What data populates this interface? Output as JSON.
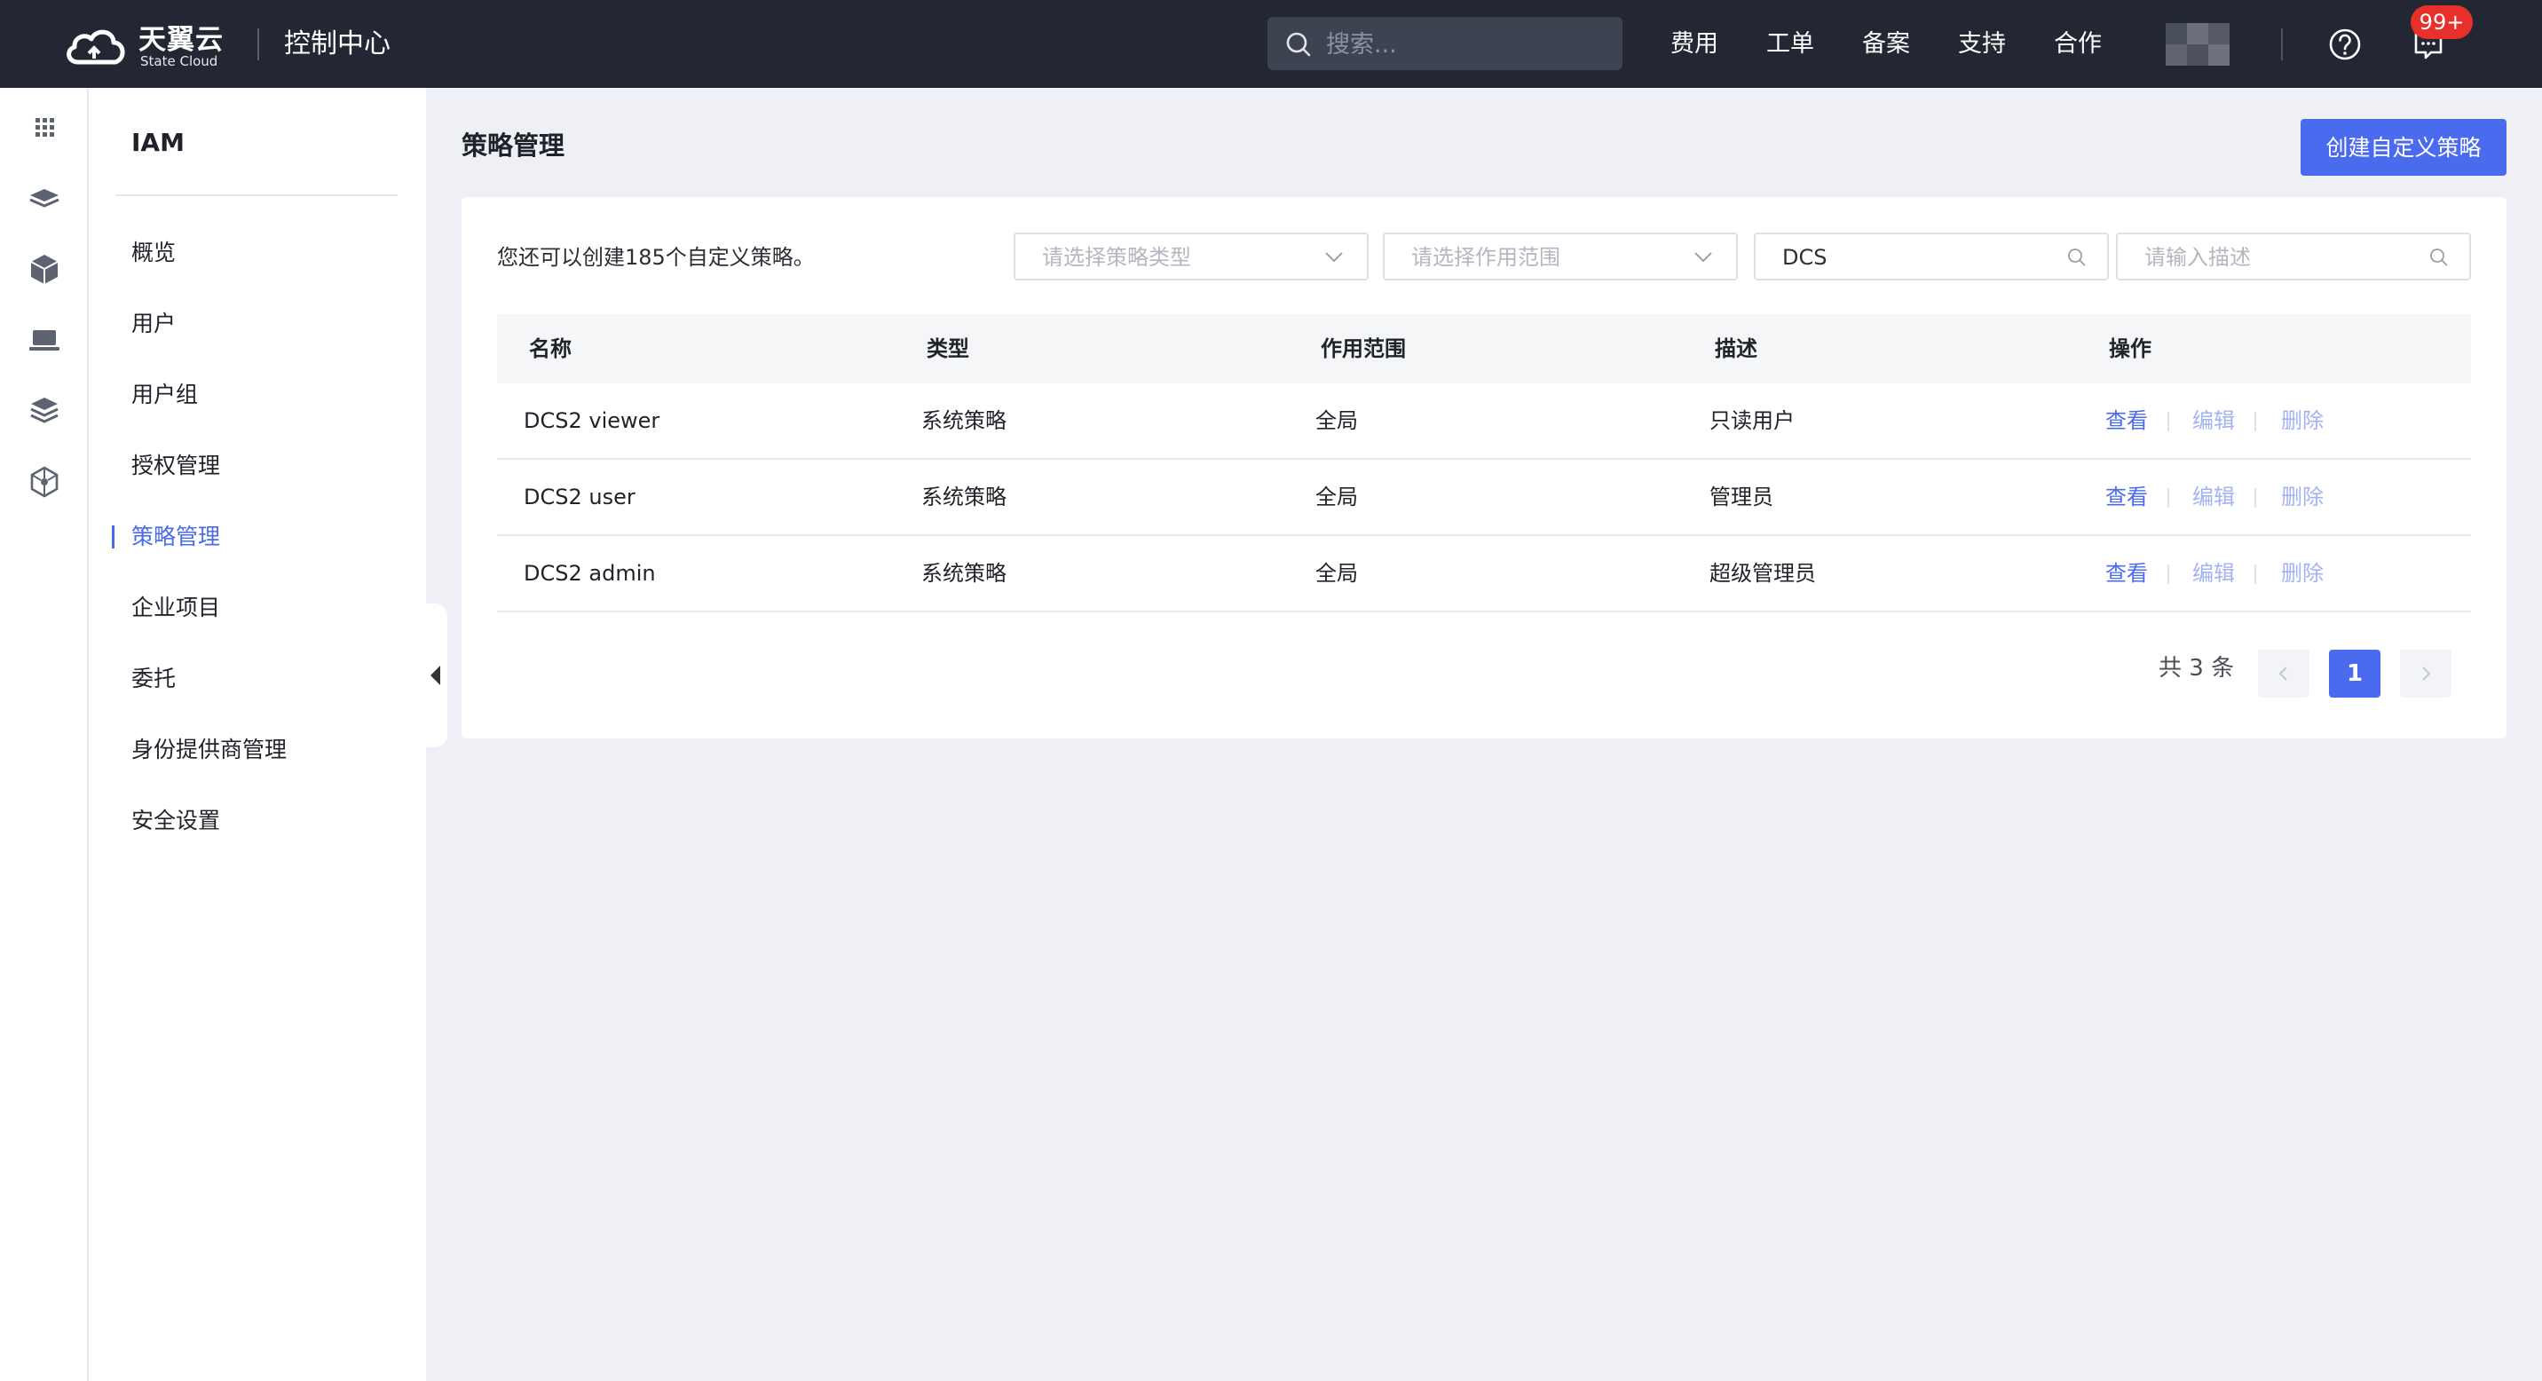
{
  "topbar": {
    "brand_name": "天翼云",
    "brand_sub": "State Cloud",
    "console_title": "控制中心",
    "search_placeholder": "搜索...",
    "nav": [
      "费用",
      "工单",
      "备案",
      "支持",
      "合作"
    ],
    "badge": "99+"
  },
  "rail": {
    "icons": [
      "grid-icon",
      "layers-icon",
      "cube-icon",
      "laptop-icon",
      "stack-icon",
      "network-icon"
    ]
  },
  "sidebar": {
    "title": "IAM",
    "items": [
      {
        "label": "概览",
        "active": false
      },
      {
        "label": "用户",
        "active": false
      },
      {
        "label": "用户组",
        "active": false
      },
      {
        "label": "授权管理",
        "active": false
      },
      {
        "label": "策略管理",
        "active": true
      },
      {
        "label": "企业项目",
        "active": false
      },
      {
        "label": "委托",
        "active": false
      },
      {
        "label": "身份提供商管理",
        "active": false
      },
      {
        "label": "安全设置",
        "active": false
      }
    ]
  },
  "main": {
    "page_title": "策略管理",
    "create_button": "创建自定义策略",
    "quota_text": "您还可以创建185个自定义策略。",
    "filters": {
      "type_placeholder": "请选择策略类型",
      "scope_placeholder": "请选择作用范围",
      "name_value": "DCS",
      "desc_placeholder": "请输入描述"
    },
    "table": {
      "headers": [
        "名称",
        "类型",
        "作用范围",
        "描述",
        "操作"
      ],
      "rows": [
        {
          "name": "DCS2 viewer",
          "type": "系统策略",
          "scope": "全局",
          "desc": "只读用户"
        },
        {
          "name": "DCS2 user",
          "type": "系统策略",
          "scope": "全局",
          "desc": "管理员"
        },
        {
          "name": "DCS2 admin",
          "type": "系统策略",
          "scope": "全局",
          "desc": "超级管理员"
        }
      ],
      "actions": {
        "view": "查看",
        "edit": "编辑",
        "delete": "删除"
      }
    },
    "pagination": {
      "total": "共 3 条",
      "current_page": "1"
    }
  },
  "colors": {
    "accent": "#4b6bee",
    "topbar": "#232733",
    "badge": "#e8302a"
  }
}
